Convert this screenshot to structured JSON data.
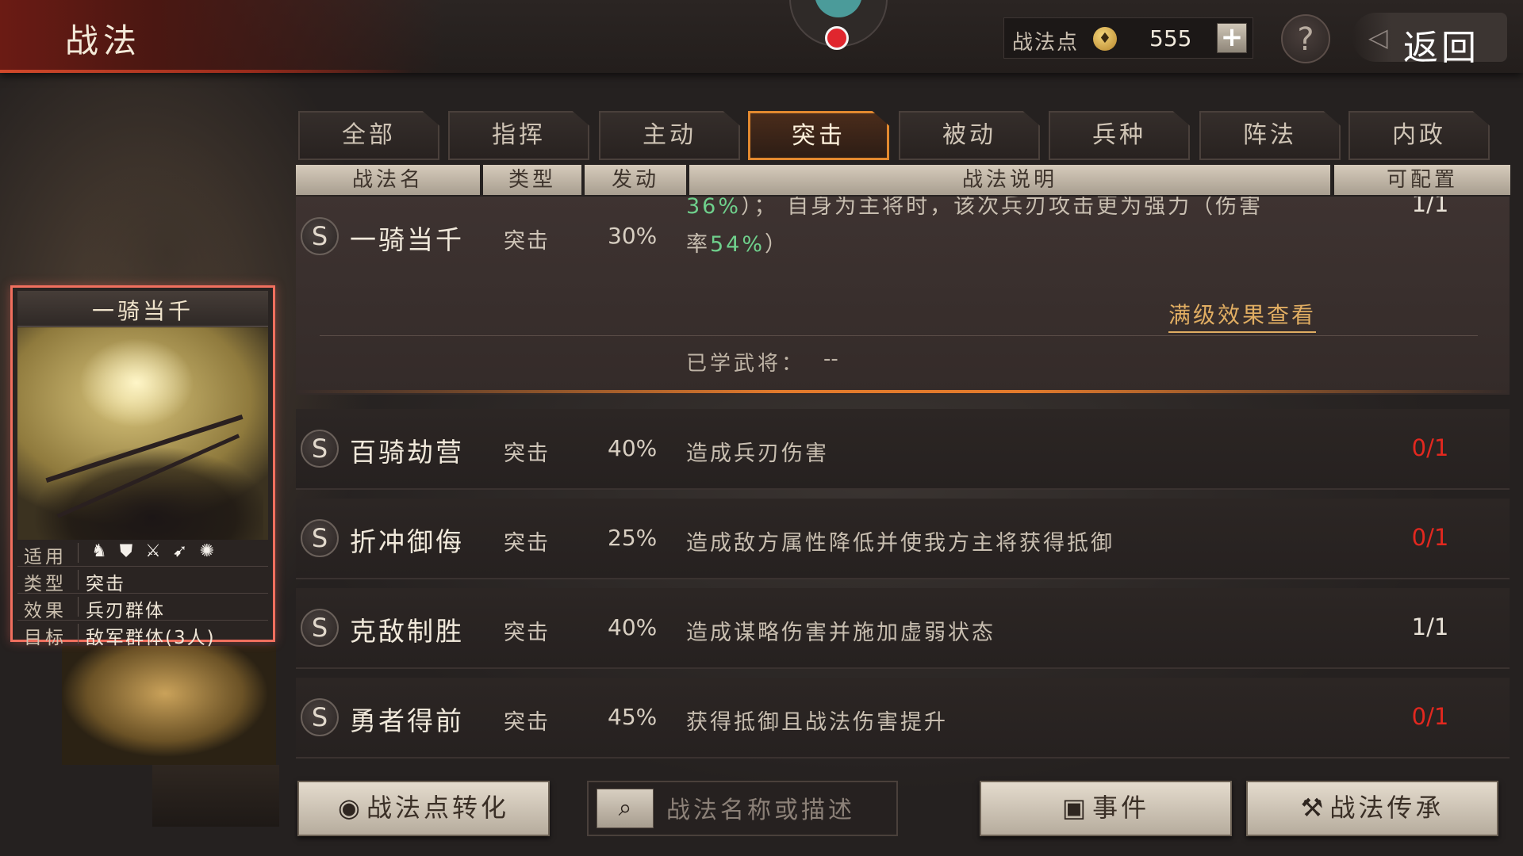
{
  "header": {
    "title": "战法",
    "points_label": "战法点",
    "points_value": "555",
    "plus_label": "+",
    "help_label": "?",
    "back_label": "返回"
  },
  "tabs": [
    {
      "label": "全部"
    },
    {
      "label": "指挥"
    },
    {
      "label": "主动"
    },
    {
      "label": "突击",
      "active": true
    },
    {
      "label": "被动"
    },
    {
      "label": "兵种"
    },
    {
      "label": "阵法"
    },
    {
      "label": "内政"
    }
  ],
  "columns": [
    "战法名",
    "类型",
    "发动",
    "战法说明",
    "可配置"
  ],
  "expanded": {
    "grade": "S",
    "name": "一骑当千",
    "type": "突击",
    "rate": "30%",
    "desc_line1_value": "36%",
    "desc_line1_text": "）； 自身为主将时，该次兵刃攻击更为强力（伤害",
    "desc_line2_prefix": "率",
    "desc_line2_value": "54%",
    "desc_line2_suffix": "）",
    "avail": "1/1",
    "max_link": "满级效果查看",
    "learned_label": "已学武将：",
    "learned_value": "--"
  },
  "rows": [
    {
      "grade": "S",
      "name": "百骑劫营",
      "type": "突击",
      "rate": "40%",
      "desc": "造成兵刃伤害",
      "avail": "0/1",
      "avail_color": "#e2281f"
    },
    {
      "grade": "S",
      "name": "折冲御侮",
      "type": "突击",
      "rate": "25%",
      "desc": "造成敌方属性降低并使我方主将获得抵御",
      "avail": "0/1",
      "avail_color": "#e2281f"
    },
    {
      "grade": "S",
      "name": "克敌制胜",
      "type": "突击",
      "rate": "40%",
      "desc": "造成谋略伤害并施加虚弱状态",
      "avail": "1/1",
      "avail_color": "#e8e1d6"
    },
    {
      "grade": "S",
      "name": "勇者得前",
      "type": "突击",
      "rate": "45%",
      "desc": "获得抵御且战法伤害提升",
      "avail": "0/1",
      "avail_color": "#e2281f"
    }
  ],
  "card": {
    "title": "一骑当千",
    "apply_label": "适用",
    "troop_icons": [
      "cavalry-icon",
      "shield-icon",
      "crossed-weapons-icon",
      "bow-icon",
      "wheel-icon"
    ],
    "type_label": "类型",
    "type_value": "突击",
    "effect_label": "效果",
    "effect_value": "兵刃群体",
    "target_label": "目标",
    "target_value": "敌军群体(3人)"
  },
  "bottom": {
    "convert_label": "战法点转化",
    "search_placeholder": "战法名称或描述",
    "event_label": "事件",
    "inherit_label": "战法传承"
  }
}
